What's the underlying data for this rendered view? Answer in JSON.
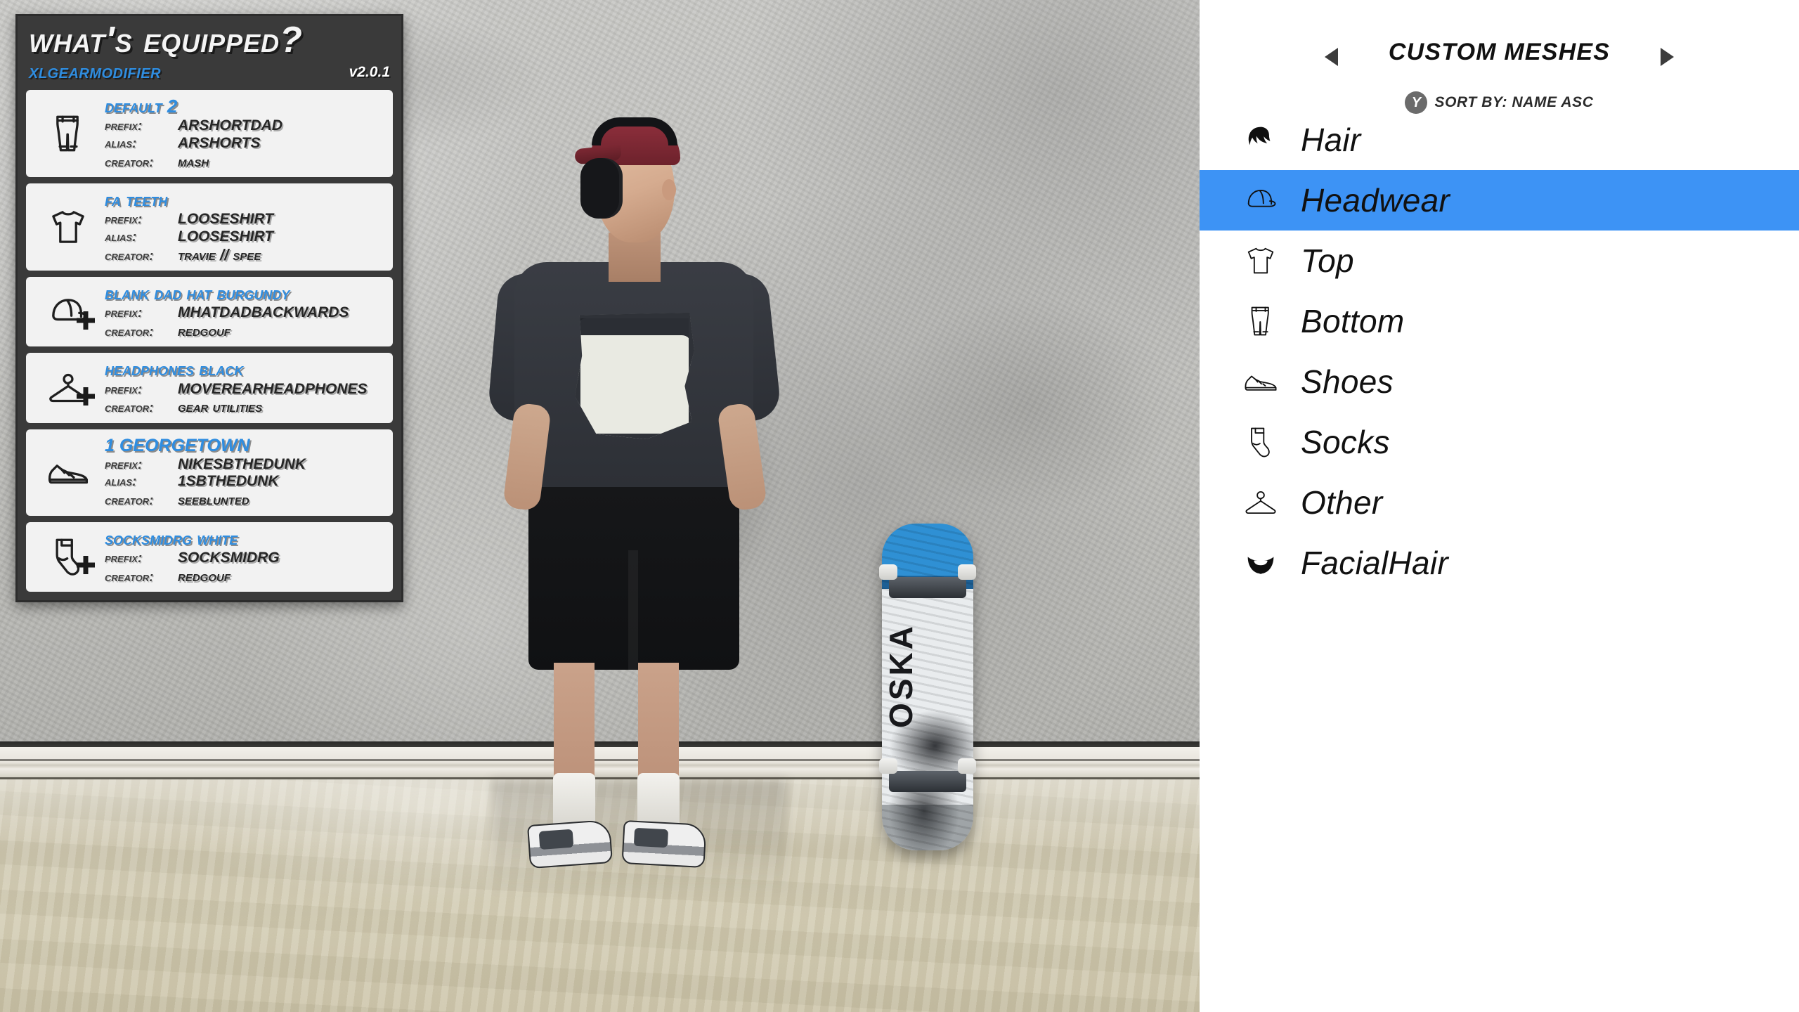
{
  "hud": {
    "title": "What's Equipped?",
    "subtitle": "XLGearModifier",
    "version": "v2.0.1",
    "labels": {
      "prefix": "Prefix:",
      "alias": "Alias:",
      "creator": "Creator:"
    },
    "cards": [
      {
        "icon": "pants-icon",
        "has_plus": false,
        "name": "Default 2",
        "name_style": "smallcaps",
        "prefix": "ARSHORTDAD",
        "alias": "ARSHORTS",
        "creator": "Mash"
      },
      {
        "icon": "tshirt-icon",
        "has_plus": false,
        "name": "FA Teeth",
        "name_style": "smallcaps",
        "prefix": "LOOSESHIRT",
        "alias": "LOOSESHIRT",
        "creator": "Travie // Spee"
      },
      {
        "icon": "cap-icon",
        "has_plus": true,
        "name": "Blank Dad Hat Burgundy",
        "name_style": "smallcaps",
        "prefix": "MHATDADBACKWARDS",
        "alias": null,
        "creator": "Redgouf"
      },
      {
        "icon": "hanger-icon",
        "has_plus": true,
        "name": "Headphones Black",
        "name_style": "smallcaps",
        "prefix": "MOVEREARHEADPHONES",
        "alias": null,
        "creator": "Gear Utilities"
      },
      {
        "icon": "shoe-icon",
        "has_plus": false,
        "name": "1 GEORGETOWN",
        "name_style": "uppercase",
        "prefix": "NIKESBTHEDUNK",
        "alias": "1SBTHEDUNK",
        "creator": "Seeblunted"
      },
      {
        "icon": "socks-icon",
        "has_plus": true,
        "name": "SocksMidRG White",
        "name_style": "smallcaps",
        "prefix": "SOCKSMIDRG",
        "alias": null,
        "creator": "Redgouf"
      }
    ]
  },
  "panel": {
    "title": "CUSTOM MESHES",
    "prev_arrow": "left-arrow",
    "next_arrow": "right-arrow",
    "sort_button": "Y",
    "sort_label": "SORT BY: NAME ASC",
    "accent_color": "#3d93f5",
    "items": [
      {
        "label": "Hair",
        "icon": "hair-icon",
        "selected": false
      },
      {
        "label": "Headwear",
        "icon": "cap-icon",
        "selected": true
      },
      {
        "label": "Top",
        "icon": "tshirt-icon",
        "selected": false
      },
      {
        "label": "Bottom",
        "icon": "pants-icon",
        "selected": false
      },
      {
        "label": "Shoes",
        "icon": "shoe-icon",
        "selected": false
      },
      {
        "label": "Socks",
        "icon": "socks-icon",
        "selected": false
      },
      {
        "label": "Other",
        "icon": "hanger-icon",
        "selected": false
      },
      {
        "label": "FacialHair",
        "icon": "beard-icon",
        "selected": false
      }
    ]
  },
  "scene": {
    "skateboard_text": "OSKA"
  }
}
